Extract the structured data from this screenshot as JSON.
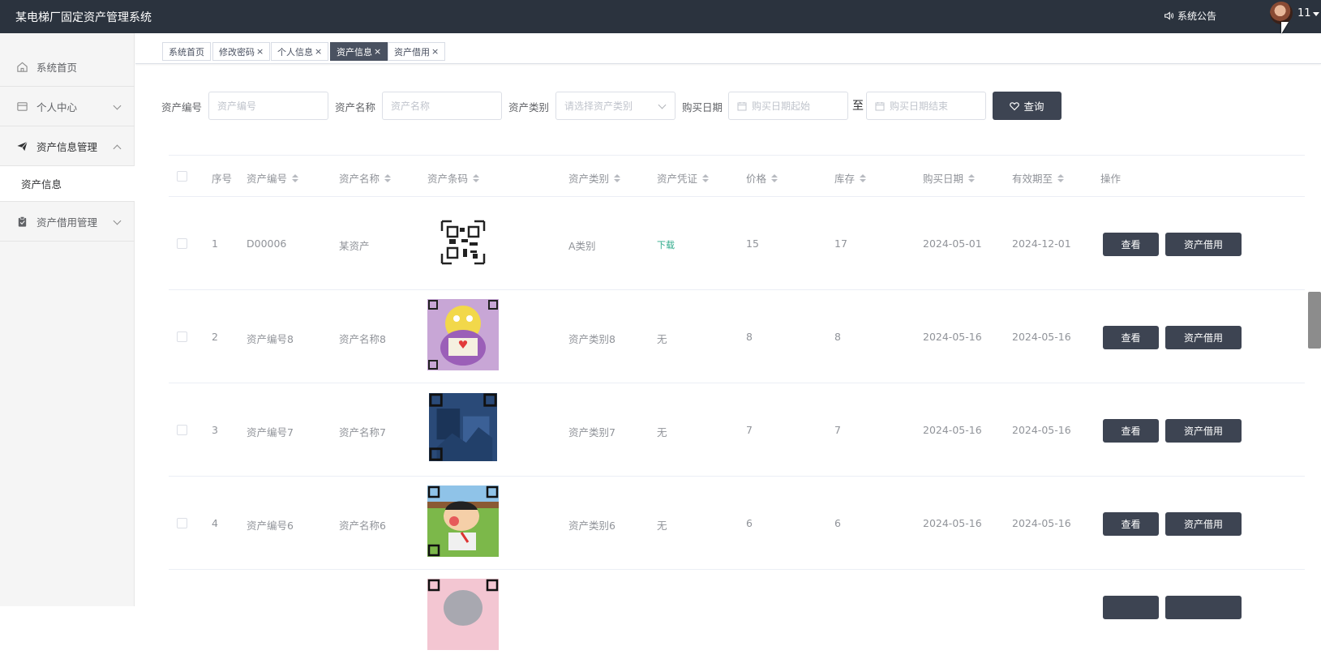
{
  "app": {
    "title": "某电梯厂固定资产管理系统",
    "notice": "系统公告",
    "username": "11"
  },
  "sidebar": {
    "items": [
      {
        "label": "系统首页"
      },
      {
        "label": "个人中心"
      },
      {
        "label": "资产信息管理"
      },
      {
        "label": "资产信息"
      },
      {
        "label": "资产借用管理"
      }
    ]
  },
  "tabs": [
    {
      "label": "系统首页"
    },
    {
      "label": "修改密码"
    },
    {
      "label": "个人信息"
    },
    {
      "label": "资产信息"
    },
    {
      "label": "资产借用"
    }
  ],
  "filters": {
    "code_label": "资产编号",
    "code_placeholder": "资产编号",
    "name_label": "资产名称",
    "name_placeholder": "资产名称",
    "category_label": "资产类别",
    "category_placeholder": "请选择资产类别",
    "date_label": "购买日期",
    "date_start_placeholder": "购买日期起始",
    "to": "至",
    "date_end_placeholder": "购买日期结束",
    "query_label": "查询"
  },
  "table": {
    "headers": [
      "序号",
      "资产编号",
      "资产名称",
      "资产条码",
      "资产类别",
      "资产凭证",
      "价格",
      "库存",
      "购买日期",
      "有效期至",
      "操作"
    ],
    "rows": [
      {
        "no": "1",
        "code": "D00006",
        "name": "某资产",
        "category": "A类别",
        "voucher": "下载",
        "price": "15",
        "stock": "17",
        "buy_date": "2024-05-01",
        "valid_to": "2024-12-01"
      },
      {
        "no": "2",
        "code": "资产编号8",
        "name": "资产名称8",
        "category": "资产类别8",
        "voucher": "无",
        "price": "8",
        "stock": "8",
        "buy_date": "2024-05-16",
        "valid_to": "2024-05-16"
      },
      {
        "no": "3",
        "code": "资产编号7",
        "name": "资产名称7",
        "category": "资产类别7",
        "voucher": "无",
        "price": "7",
        "stock": "7",
        "buy_date": "2024-05-16",
        "valid_to": "2024-05-16"
      },
      {
        "no": "4",
        "code": "资产编号6",
        "name": "资产名称6",
        "category": "资产类别6",
        "voucher": "无",
        "price": "6",
        "stock": "6",
        "buy_date": "2024-05-16",
        "valid_to": "2024-05-16"
      }
    ],
    "view_label": "查看",
    "borrow_label": "资产借用"
  }
}
